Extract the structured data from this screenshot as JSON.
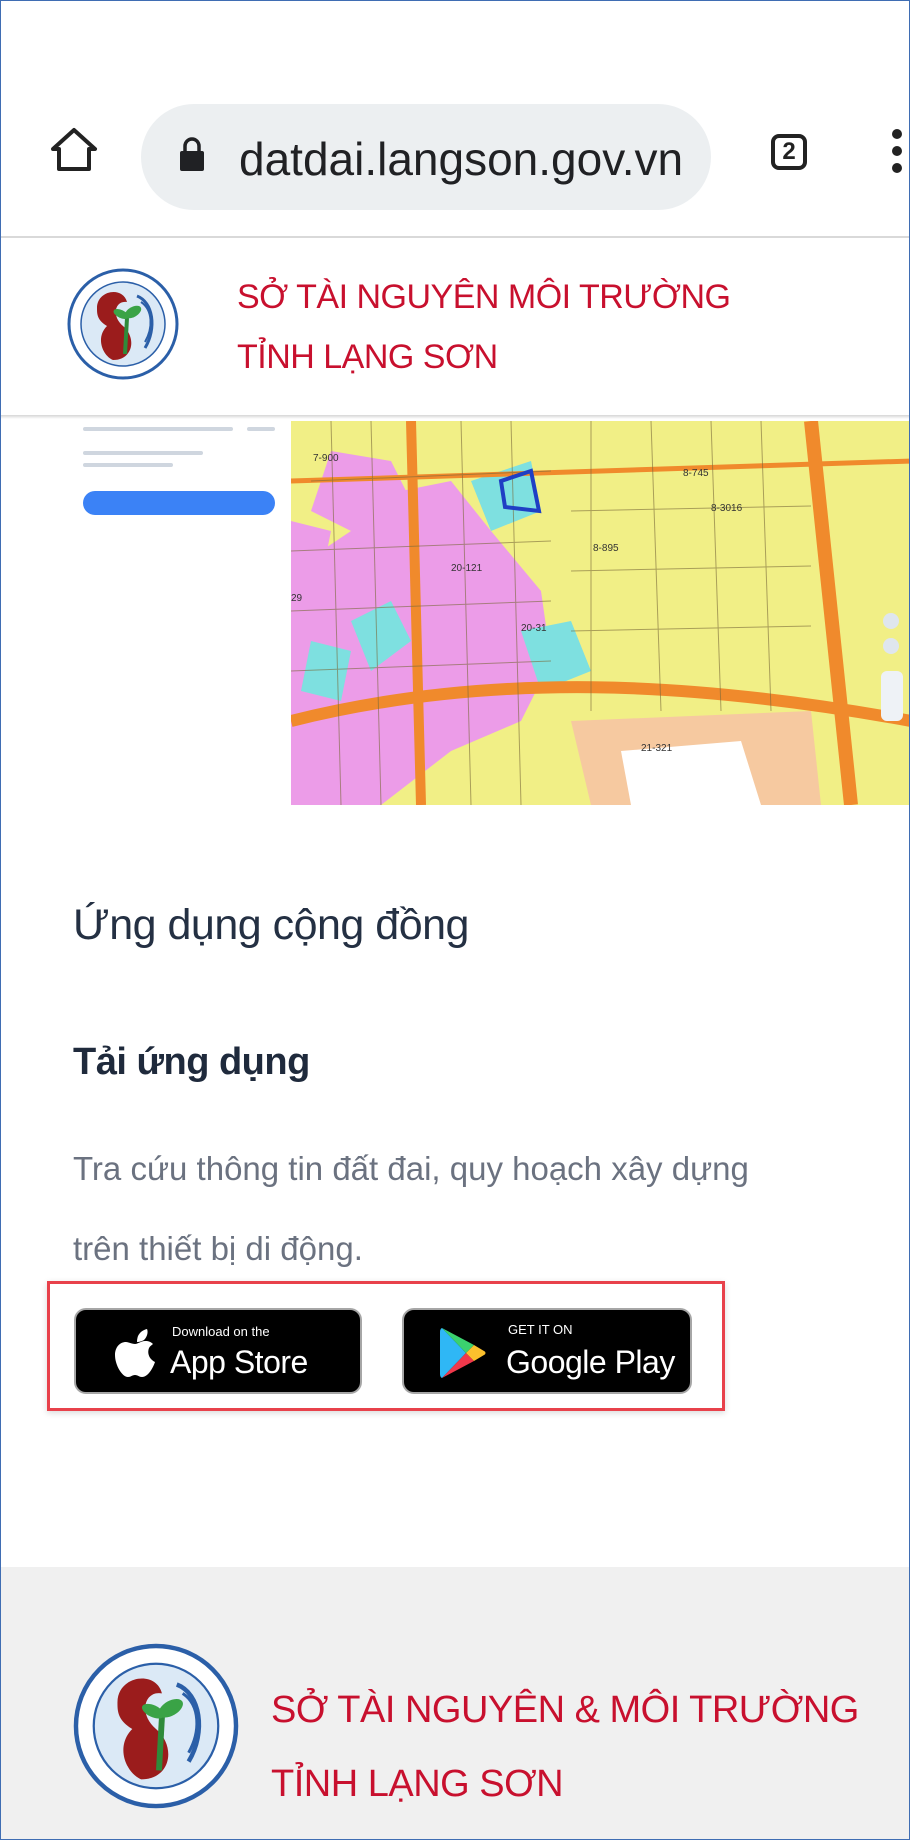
{
  "browser": {
    "url": "datdai.langson.gov.vn",
    "tab_count": "2",
    "icons": [
      "home-icon",
      "lock-icon",
      "tabs-icon",
      "more-vert-icon"
    ]
  },
  "header": {
    "org_line1": "SỞ TÀI NGUYÊN MÔI TRƯỜNG",
    "org_line2": "TỈNH LẠNG SƠN"
  },
  "map": {
    "parcel_labels": [
      "7-900",
      "8-745",
      "8-3016",
      "8-895",
      "20-121",
      "20-31",
      "29",
      "21-321"
    ]
  },
  "content": {
    "section_title": "Ứng dụng cộng đồng",
    "download_title": "Tải ứng dụng",
    "description_line1": "Tra cứu thông tin đất đai, quy hoạch xây dựng",
    "description_line2": "trên thiết bị di động."
  },
  "badges": {
    "appstore_small": "Download on the",
    "appstore_big": "App Store",
    "gplay_small": "GET IT ON",
    "gplay_big": "Google Play"
  },
  "footer": {
    "org_line1": "SỞ TÀI NGUYÊN & MÔI TRƯỜNG",
    "org_line2": "TỈNH LẠNG SƠN"
  },
  "colors": {
    "org_red": "#c8102e",
    "highlight": "#e8414b",
    "text_dark": "#243043",
    "text_muted": "#6b7280",
    "footer_bg": "#f0f0f0"
  }
}
